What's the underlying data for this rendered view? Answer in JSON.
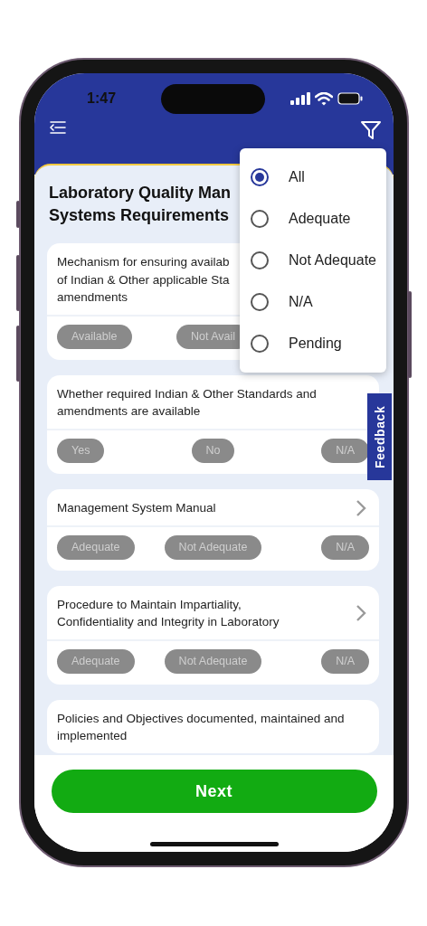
{
  "status_bar": {
    "time": "1:47"
  },
  "section": {
    "title_lines": [
      "Laboratory Quality Man",
      "Systems Requirements"
    ]
  },
  "questions": [
    {
      "lines": [
        "Mechanism for ensuring availab",
        "of Indian & Other applicable Sta",
        "amendments"
      ],
      "options": [
        {
          "label": "Available",
          "selected": false
        },
        {
          "label": "Not Avail",
          "selected": false
        }
      ]
    },
    {
      "lines": [
        "Whether required Indian & Other Standards and",
        "amendments are available"
      ],
      "chevron": false,
      "options": [
        {
          "label": "Yes",
          "selected": false
        },
        {
          "label": "No",
          "selected": false
        },
        {
          "label": "N/A",
          "selected": false
        }
      ]
    },
    {
      "lines": [
        "Management System Manual"
      ],
      "chevron": true,
      "options": [
        {
          "label": "Adequate",
          "selected": false
        },
        {
          "label": "Not Adequate",
          "selected": false
        },
        {
          "label": "N/A",
          "selected": false
        }
      ]
    },
    {
      "lines": [
        "Procedure to Maintain Impartiality,",
        "Confidentiality and Integrity in Laboratory"
      ],
      "chevron": true,
      "options": [
        {
          "label": "Adequate",
          "selected": false
        },
        {
          "label": "Not Adequate",
          "selected": false
        },
        {
          "label": "N/A",
          "selected": false
        }
      ]
    },
    {
      "lines": [
        "Policies and Objectives documented, maintained and",
        "implemented"
      ],
      "chevron": false
    }
  ],
  "filter_menu": {
    "options": [
      {
        "label": "All",
        "selected": true
      },
      {
        "label": "Adequate",
        "selected": false
      },
      {
        "label": "Not Adequate",
        "selected": false
      },
      {
        "label": "N/A",
        "selected": false
      },
      {
        "label": "Pending",
        "selected": false
      }
    ]
  },
  "feedback_tab": {
    "label": "Feedback"
  },
  "next_button": {
    "label": "Next"
  }
}
